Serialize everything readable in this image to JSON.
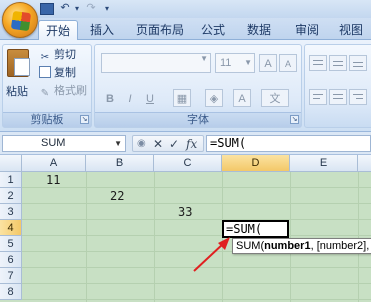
{
  "quick_access": {
    "icons": [
      "office-button",
      "save-icon",
      "undo-icon",
      "redo-icon",
      "customize-icon"
    ]
  },
  "tabs": [
    "开始",
    "插入",
    "页面布局",
    "公式",
    "数据",
    "审阅",
    "视图"
  ],
  "clipboard": {
    "paste": "粘贴",
    "cut": "剪切",
    "copy": "复制",
    "format_painter": "格式刷",
    "group_label": "剪贴板"
  },
  "font": {
    "size": "11",
    "group_label": "字体"
  },
  "formula_bar": {
    "name_box": "SUM",
    "formula": "=SUM("
  },
  "grid": {
    "columns": [
      "A",
      "B",
      "C",
      "D",
      "E"
    ],
    "rows": [
      "1",
      "2",
      "3",
      "4",
      "5",
      "6",
      "7",
      "8"
    ],
    "cells": {
      "A1": "11",
      "B2": "22",
      "C3": "33",
      "D4": "=SUM("
    },
    "active_cell": "D4"
  },
  "tooltip": {
    "func": "SUM(",
    "arg1": "number1",
    "rest": ", [number2], ...)"
  },
  "colors": {
    "sheet_bg": "#c8e0c4",
    "selection_header": "#f3c868",
    "arrow": "#e02020"
  }
}
